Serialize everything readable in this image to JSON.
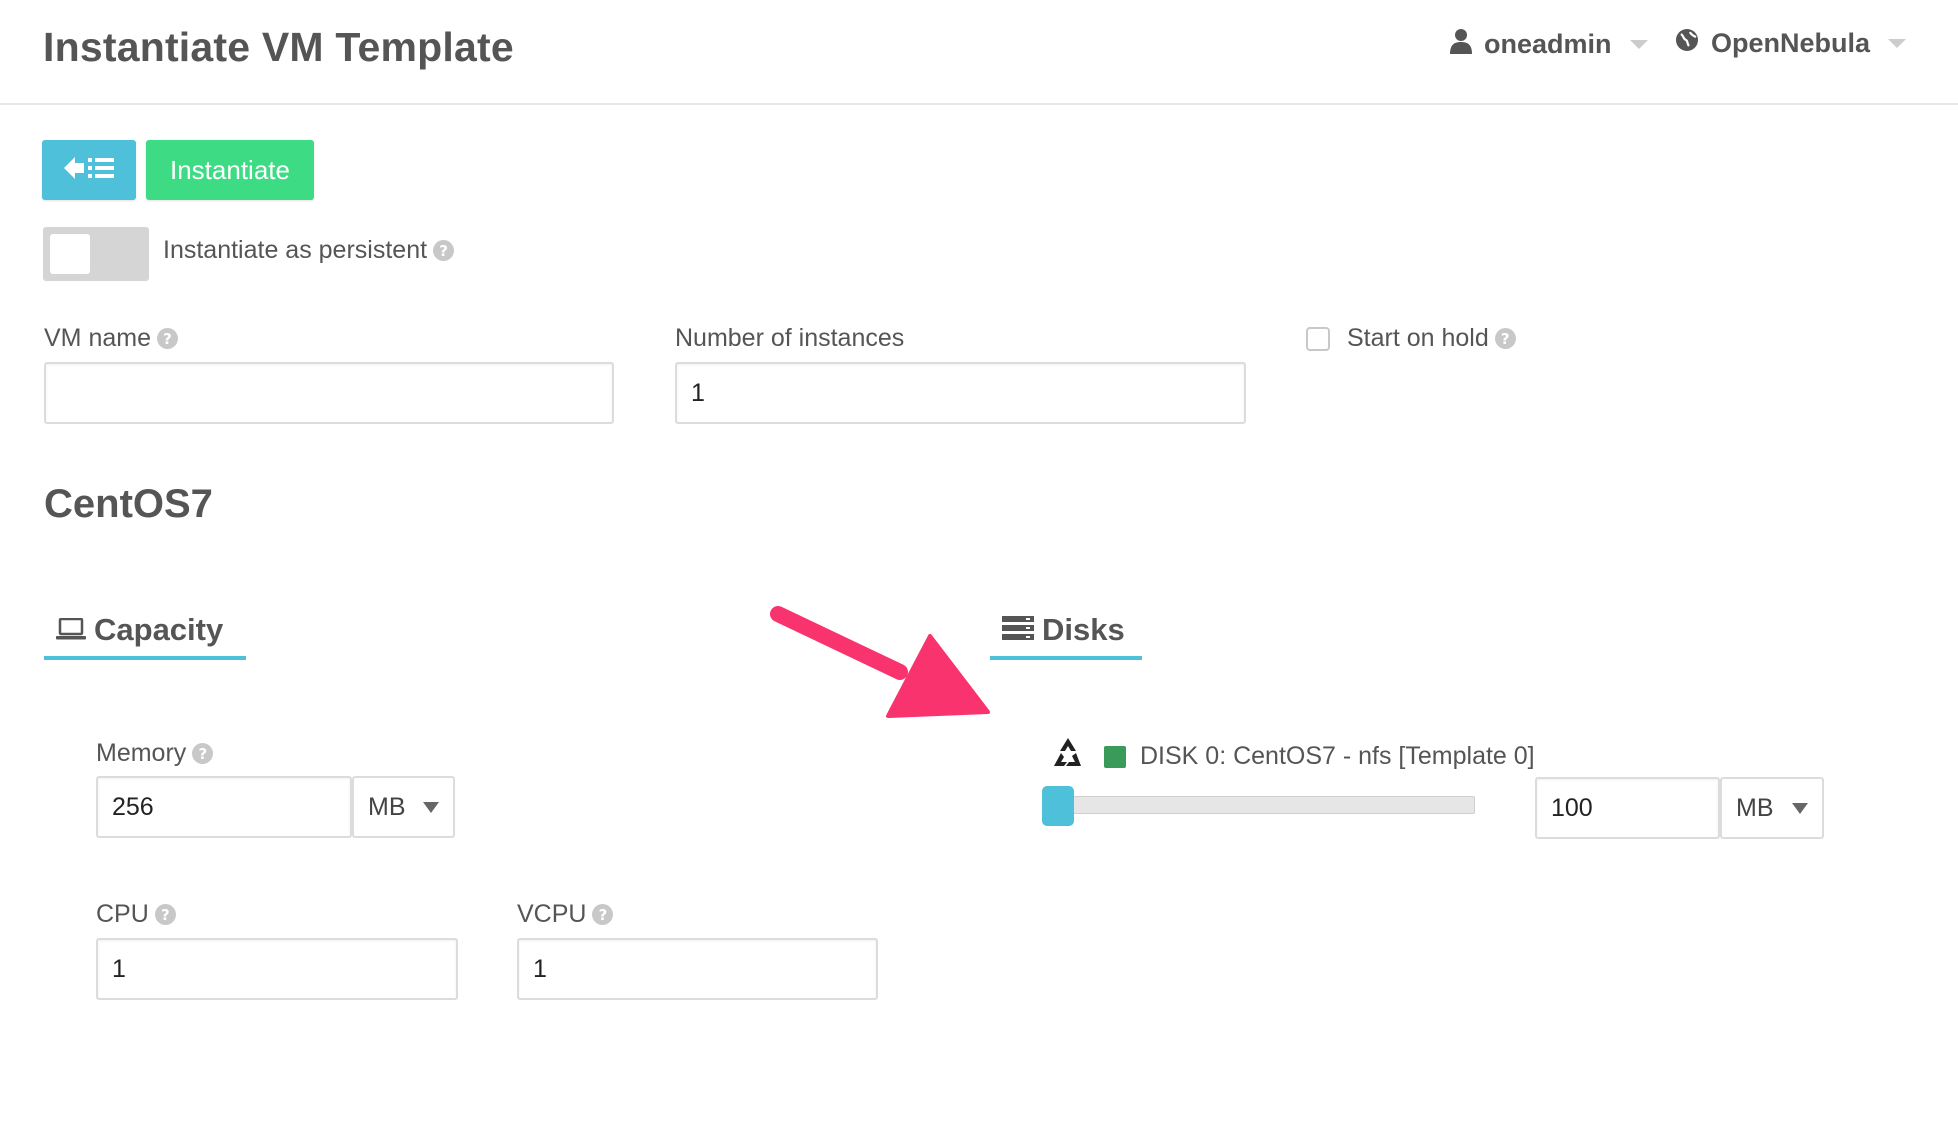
{
  "header": {
    "title": "Instantiate VM Template",
    "user": "oneadmin",
    "zone": "OpenNebula"
  },
  "toolbar": {
    "back_icon": "list-back-icon",
    "instantiate_label": "Instantiate"
  },
  "persistent": {
    "label": "Instantiate as persistent",
    "enabled": false
  },
  "form": {
    "vm_name": {
      "label": "VM name",
      "value": ""
    },
    "instances": {
      "label": "Number of instances",
      "value": "1"
    },
    "hold": {
      "label": "Start on hold",
      "checked": false
    }
  },
  "template_name": "CentOS7",
  "capacity": {
    "title": "Capacity",
    "memory": {
      "label": "Memory",
      "value": "256",
      "unit": "MB"
    },
    "cpu": {
      "label": "CPU",
      "value": "1"
    },
    "vcpu": {
      "label": "VCPU",
      "value": "1"
    }
  },
  "disks": {
    "title": "Disks",
    "disk0": {
      "label": "DISK 0: CentOS7 - nfs [Template 0]",
      "size": "100",
      "unit": "MB",
      "slider_level": 0.0,
      "color": "#3a9a5a"
    }
  },
  "annotation": {
    "arrow_color": "#f8336e"
  },
  "colors": {
    "accent": "#4fc0d9",
    "success": "#3ddc84"
  }
}
